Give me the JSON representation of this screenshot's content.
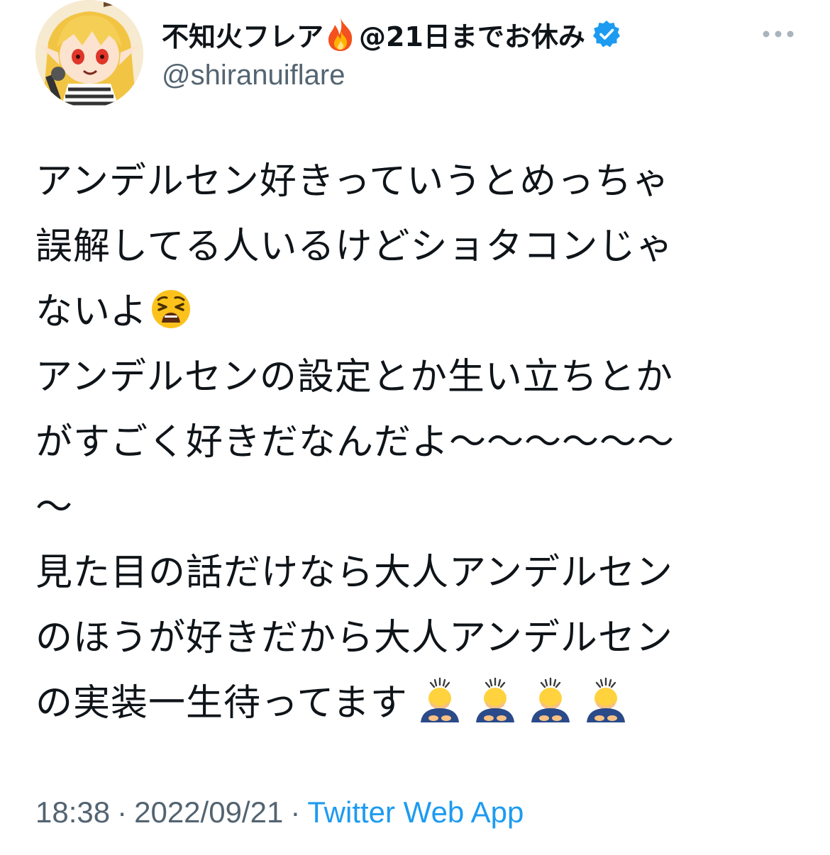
{
  "user": {
    "display_name": "不知火フレア",
    "status_text": "@21日までお休み",
    "handle": "@shiranuiflare",
    "verified": true
  },
  "tweet": {
    "lines": [
      "アンデルセン好きっていうとめっちゃ",
      "誤解してる人いるけどショタコンじゃ",
      "ないよ",
      "アンデルセンの設定とか生い立ちとか",
      "がすごく好きだなんだよ〜〜〜〜〜〜",
      "〜",
      "見た目の話だけなら大人アンデルセン",
      "のほうが好きだから大人アンデルセン",
      "の実装一生待ってます"
    ],
    "emojis": {
      "after_line_3": "weary-face",
      "after_line_9": [
        "person-bowing",
        "person-bowing",
        "person-bowing",
        "person-bowing"
      ]
    }
  },
  "meta": {
    "time": "18:38",
    "date": "2022/09/21",
    "separator": "·",
    "client": "Twitter Web App"
  },
  "icons": {
    "name_emoji": "fire-icon",
    "badge": "verified-badge-icon",
    "menu": "more-options-icon"
  },
  "colors": {
    "text": "#0f1419",
    "secondary": "#536471",
    "link": "#1d9bf0",
    "verified": "#1d9bf0"
  }
}
